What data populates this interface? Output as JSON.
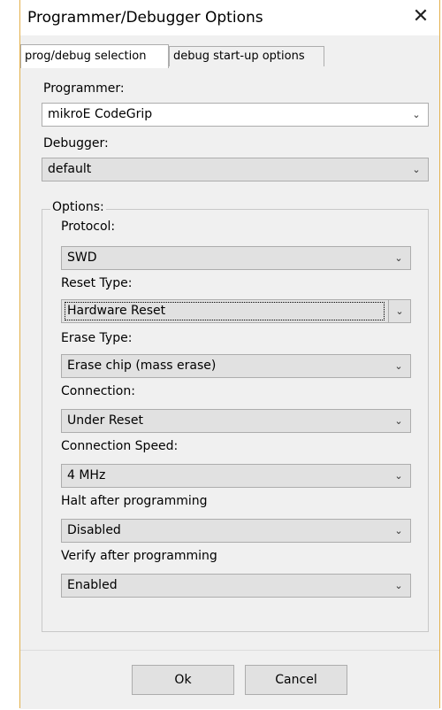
{
  "window": {
    "title": "Programmer/Debugger  Options",
    "close_glyph": "✕"
  },
  "tabs": [
    {
      "label": "prog/debug selection",
      "active": true
    },
    {
      "label": "debug start-up options",
      "active": false
    }
  ],
  "programmer": {
    "label": "Programmer:",
    "value": "mikroE CodeGrip"
  },
  "debugger": {
    "label": "Debugger:",
    "value": "default"
  },
  "options_group": {
    "title": "Options:",
    "fields": [
      {
        "label": "Protocol:",
        "value": "SWD"
      },
      {
        "label": "Reset Type:",
        "value": "Hardware Reset"
      },
      {
        "label": "Erase Type:",
        "value": "Erase chip (mass erase)"
      },
      {
        "label": "Connection:",
        "value": "Under Reset"
      },
      {
        "label": "Connection Speed:",
        "value": "4 MHz"
      },
      {
        "label": "Halt after programming",
        "value": "Disabled"
      },
      {
        "label": "Verify after programming",
        "value": "Enabled"
      }
    ]
  },
  "buttons": {
    "ok": "Ok",
    "cancel": "Cancel"
  },
  "icons": {
    "dropdown": "chevron-down-icon",
    "close": "close-icon"
  }
}
